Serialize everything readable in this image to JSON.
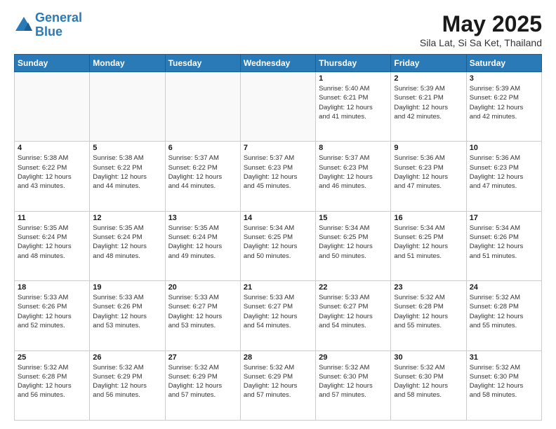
{
  "logo": {
    "line1": "General",
    "line2": "Blue"
  },
  "title": "May 2025",
  "location": "Sila Lat, Si Sa Ket, Thailand",
  "days_header": [
    "Sunday",
    "Monday",
    "Tuesday",
    "Wednesday",
    "Thursday",
    "Friday",
    "Saturday"
  ],
  "weeks": [
    [
      {
        "day": "",
        "info": ""
      },
      {
        "day": "",
        "info": ""
      },
      {
        "day": "",
        "info": ""
      },
      {
        "day": "",
        "info": ""
      },
      {
        "day": "1",
        "info": "Sunrise: 5:40 AM\nSunset: 6:21 PM\nDaylight: 12 hours\nand 41 minutes."
      },
      {
        "day": "2",
        "info": "Sunrise: 5:39 AM\nSunset: 6:21 PM\nDaylight: 12 hours\nand 42 minutes."
      },
      {
        "day": "3",
        "info": "Sunrise: 5:39 AM\nSunset: 6:22 PM\nDaylight: 12 hours\nand 42 minutes."
      }
    ],
    [
      {
        "day": "4",
        "info": "Sunrise: 5:38 AM\nSunset: 6:22 PM\nDaylight: 12 hours\nand 43 minutes."
      },
      {
        "day": "5",
        "info": "Sunrise: 5:38 AM\nSunset: 6:22 PM\nDaylight: 12 hours\nand 44 minutes."
      },
      {
        "day": "6",
        "info": "Sunrise: 5:37 AM\nSunset: 6:22 PM\nDaylight: 12 hours\nand 44 minutes."
      },
      {
        "day": "7",
        "info": "Sunrise: 5:37 AM\nSunset: 6:23 PM\nDaylight: 12 hours\nand 45 minutes."
      },
      {
        "day": "8",
        "info": "Sunrise: 5:37 AM\nSunset: 6:23 PM\nDaylight: 12 hours\nand 46 minutes."
      },
      {
        "day": "9",
        "info": "Sunrise: 5:36 AM\nSunset: 6:23 PM\nDaylight: 12 hours\nand 47 minutes."
      },
      {
        "day": "10",
        "info": "Sunrise: 5:36 AM\nSunset: 6:23 PM\nDaylight: 12 hours\nand 47 minutes."
      }
    ],
    [
      {
        "day": "11",
        "info": "Sunrise: 5:35 AM\nSunset: 6:24 PM\nDaylight: 12 hours\nand 48 minutes."
      },
      {
        "day": "12",
        "info": "Sunrise: 5:35 AM\nSunset: 6:24 PM\nDaylight: 12 hours\nand 48 minutes."
      },
      {
        "day": "13",
        "info": "Sunrise: 5:35 AM\nSunset: 6:24 PM\nDaylight: 12 hours\nand 49 minutes."
      },
      {
        "day": "14",
        "info": "Sunrise: 5:34 AM\nSunset: 6:25 PM\nDaylight: 12 hours\nand 50 minutes."
      },
      {
        "day": "15",
        "info": "Sunrise: 5:34 AM\nSunset: 6:25 PM\nDaylight: 12 hours\nand 50 minutes."
      },
      {
        "day": "16",
        "info": "Sunrise: 5:34 AM\nSunset: 6:25 PM\nDaylight: 12 hours\nand 51 minutes."
      },
      {
        "day": "17",
        "info": "Sunrise: 5:34 AM\nSunset: 6:26 PM\nDaylight: 12 hours\nand 51 minutes."
      }
    ],
    [
      {
        "day": "18",
        "info": "Sunrise: 5:33 AM\nSunset: 6:26 PM\nDaylight: 12 hours\nand 52 minutes."
      },
      {
        "day": "19",
        "info": "Sunrise: 5:33 AM\nSunset: 6:26 PM\nDaylight: 12 hours\nand 53 minutes."
      },
      {
        "day": "20",
        "info": "Sunrise: 5:33 AM\nSunset: 6:27 PM\nDaylight: 12 hours\nand 53 minutes."
      },
      {
        "day": "21",
        "info": "Sunrise: 5:33 AM\nSunset: 6:27 PM\nDaylight: 12 hours\nand 54 minutes."
      },
      {
        "day": "22",
        "info": "Sunrise: 5:33 AM\nSunset: 6:27 PM\nDaylight: 12 hours\nand 54 minutes."
      },
      {
        "day": "23",
        "info": "Sunrise: 5:32 AM\nSunset: 6:28 PM\nDaylight: 12 hours\nand 55 minutes."
      },
      {
        "day": "24",
        "info": "Sunrise: 5:32 AM\nSunset: 6:28 PM\nDaylight: 12 hours\nand 55 minutes."
      }
    ],
    [
      {
        "day": "25",
        "info": "Sunrise: 5:32 AM\nSunset: 6:28 PM\nDaylight: 12 hours\nand 56 minutes."
      },
      {
        "day": "26",
        "info": "Sunrise: 5:32 AM\nSunset: 6:29 PM\nDaylight: 12 hours\nand 56 minutes."
      },
      {
        "day": "27",
        "info": "Sunrise: 5:32 AM\nSunset: 6:29 PM\nDaylight: 12 hours\nand 57 minutes."
      },
      {
        "day": "28",
        "info": "Sunrise: 5:32 AM\nSunset: 6:29 PM\nDaylight: 12 hours\nand 57 minutes."
      },
      {
        "day": "29",
        "info": "Sunrise: 5:32 AM\nSunset: 6:30 PM\nDaylight: 12 hours\nand 57 minutes."
      },
      {
        "day": "30",
        "info": "Sunrise: 5:32 AM\nSunset: 6:30 PM\nDaylight: 12 hours\nand 58 minutes."
      },
      {
        "day": "31",
        "info": "Sunrise: 5:32 AM\nSunset: 6:30 PM\nDaylight: 12 hours\nand 58 minutes."
      }
    ]
  ]
}
